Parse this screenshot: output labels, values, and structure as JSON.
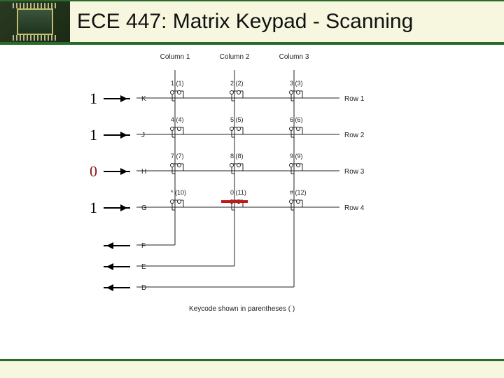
{
  "title": "ECE 447: Matrix Keypad - Scanning",
  "columns": [
    "Column 1",
    "Column 2",
    "Column 3"
  ],
  "rows": [
    "Row 1",
    "Row 2",
    "Row 3",
    "Row 4"
  ],
  "row_pins": [
    "K",
    "J",
    "H",
    "G"
  ],
  "col_pins": [
    "F",
    "E",
    "D"
  ],
  "inputs": [
    "1",
    "1",
    "0",
    "1"
  ],
  "keys": [
    [
      "1 (1)",
      "2 (2)",
      "3 (3)"
    ],
    [
      "4 (4)",
      "5 (5)",
      "6 (6)"
    ],
    [
      "7 (7)",
      "8 (8)",
      "9 (9)"
    ],
    [
      "* (10)",
      "0 (11)",
      "# (12)"
    ]
  ],
  "caption": "Keycode shown in parentheses ( )",
  "highlight_row": 3,
  "highlight_col": 1
}
